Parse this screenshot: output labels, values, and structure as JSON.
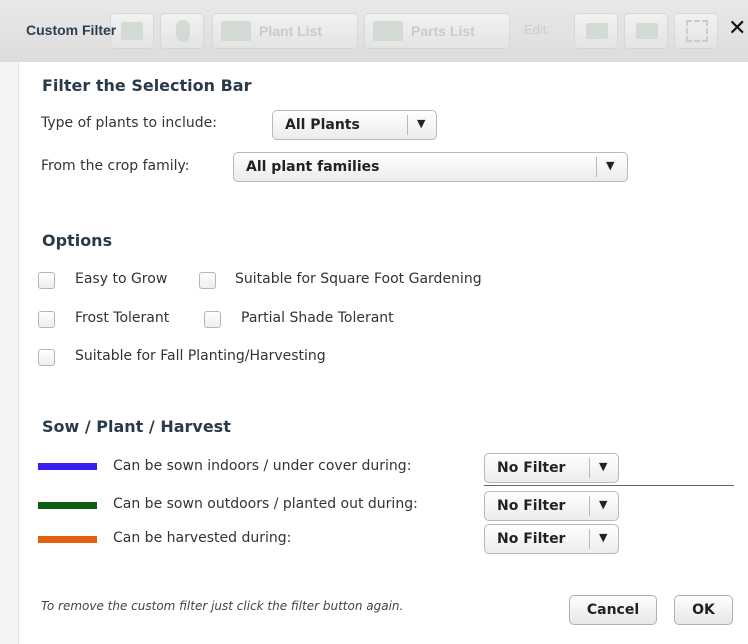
{
  "dialog": {
    "title": "Custom Filter",
    "close_glyph": "✕"
  },
  "toolbar": {
    "plant_list_label": "Plant List",
    "parts_list_label": "Parts List",
    "edit_label": "Edit:"
  },
  "filter_selection": {
    "heading": "Filter the Selection Bar",
    "plant_type_label": "Type of plants to include:",
    "plant_type_value": "All Plants",
    "crop_family_label": "From the crop family:",
    "crop_family_value": "All plant families"
  },
  "options": {
    "heading": "Options",
    "items": [
      {
        "label": "Easy to Grow",
        "checked": false
      },
      {
        "label": "Suitable for Square Foot Gardening",
        "checked": false
      },
      {
        "label": "Frost Tolerant",
        "checked": false
      },
      {
        "label": "Partial Shade Tolerant",
        "checked": false
      },
      {
        "label": "Suitable for Fall Planting/Harvesting",
        "checked": false
      }
    ]
  },
  "sow_plant_harvest": {
    "heading": "Sow / Plant / Harvest",
    "rows": [
      {
        "label": "Can be sown indoors / under cover during:",
        "value": "No Filter",
        "color": "#3a1ef0"
      },
      {
        "label": "Can be sown outdoors / planted out during:",
        "value": "No Filter",
        "color": "#0d5e12"
      },
      {
        "label": "Can be harvested during:",
        "value": "No Filter",
        "color": "#e0600e"
      }
    ]
  },
  "footer": {
    "note": "To remove the custom filter just click the filter button again.",
    "cancel_label": "Cancel",
    "ok_label": "OK"
  },
  "icons": {
    "dropdown": "▼"
  }
}
